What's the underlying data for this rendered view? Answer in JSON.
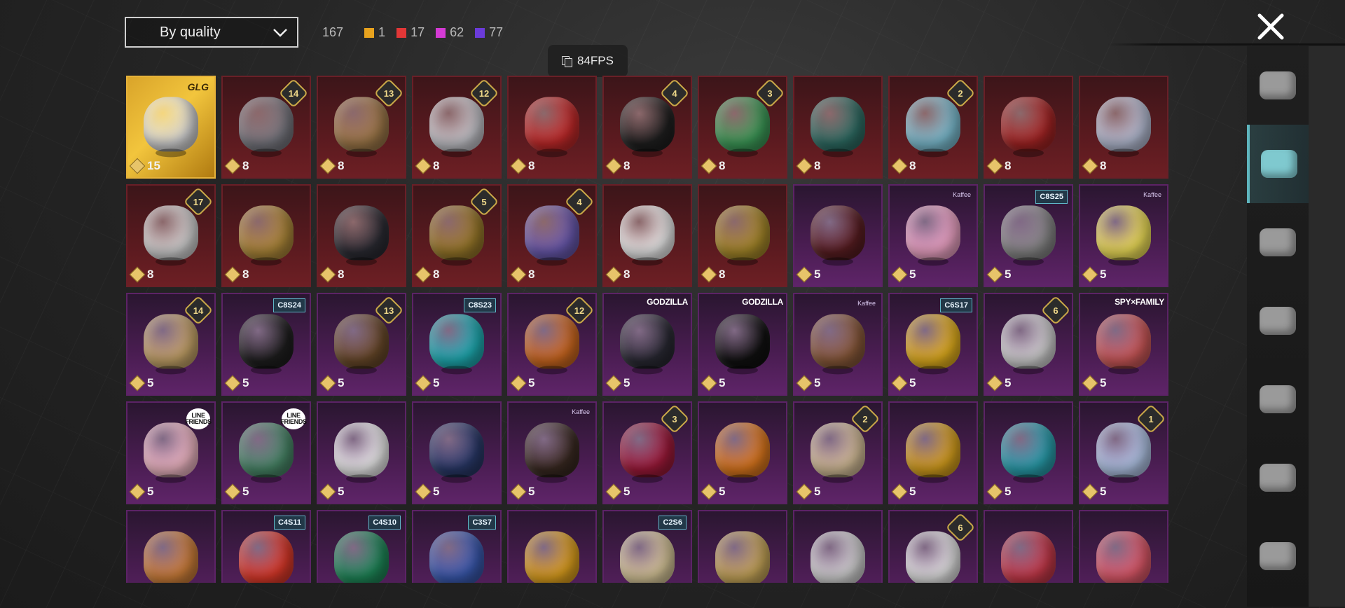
{
  "toolbar": {
    "sort_label": "By quality",
    "total": "167",
    "counts": [
      {
        "color": "#e7a21e",
        "value": "1"
      },
      {
        "color": "#e23737",
        "value": "17"
      },
      {
        "color": "#d43ad4",
        "value": "62"
      },
      {
        "color": "#6b3bd9",
        "value": "77"
      }
    ]
  },
  "overlay": {
    "fps": "84FPS"
  },
  "categories": [
    {
      "name": "glove-icon",
      "selected": false
    },
    {
      "name": "hat-icon",
      "selected": true
    },
    {
      "name": "glasses-icon",
      "selected": false
    },
    {
      "name": "mask-icon",
      "selected": false
    },
    {
      "name": "jacket-icon",
      "selected": false
    },
    {
      "name": "backpack-icon",
      "selected": false
    },
    {
      "name": "pants-icon",
      "selected": false
    }
  ],
  "items": [
    {
      "quality": "gold",
      "points": "15",
      "logo": "GLG"
    },
    {
      "quality": "red",
      "points": "8",
      "badge": "14"
    },
    {
      "quality": "red",
      "points": "8",
      "badge": "13"
    },
    {
      "quality": "red",
      "points": "8",
      "badge": "12"
    },
    {
      "quality": "red",
      "points": "8"
    },
    {
      "quality": "red",
      "points": "8",
      "badge": "4"
    },
    {
      "quality": "red",
      "points": "8",
      "badge": "3"
    },
    {
      "quality": "red",
      "points": "8"
    },
    {
      "quality": "red",
      "points": "8",
      "badge": "2"
    },
    {
      "quality": "red",
      "points": "8"
    },
    {
      "quality": "red",
      "points": "8"
    },
    {
      "quality": "red",
      "points": "8",
      "badge": "17"
    },
    {
      "quality": "red",
      "points": "8"
    },
    {
      "quality": "red",
      "points": "8"
    },
    {
      "quality": "red",
      "points": "8",
      "badge": "5"
    },
    {
      "quality": "red",
      "points": "8",
      "badge": "4"
    },
    {
      "quality": "red",
      "points": "8"
    },
    {
      "quality": "red",
      "points": "8"
    },
    {
      "quality": "purple",
      "points": "5"
    },
    {
      "quality": "purple",
      "points": "5",
      "kaffee": "Kaffee"
    },
    {
      "quality": "purple",
      "points": "5",
      "tag": "C8S25"
    },
    {
      "quality": "purple",
      "points": "5",
      "kaffee": "Kaffee"
    },
    {
      "quality": "purple",
      "points": "5",
      "badge": "14"
    },
    {
      "quality": "purple",
      "points": "5",
      "tag": "C8S24"
    },
    {
      "quality": "purple",
      "points": "5",
      "badge": "13"
    },
    {
      "quality": "purple",
      "points": "5",
      "tag": "C8S23"
    },
    {
      "quality": "purple",
      "points": "5",
      "badge": "12"
    },
    {
      "quality": "purple",
      "points": "5",
      "brand": "GODZILLA"
    },
    {
      "quality": "purple",
      "points": "5",
      "brand": "GODZILLA"
    },
    {
      "quality": "purple",
      "points": "5",
      "kaffee": "Kaffee"
    },
    {
      "quality": "purple",
      "points": "5",
      "tag": "C6S17"
    },
    {
      "quality": "purple",
      "points": "5",
      "badge": "6"
    },
    {
      "quality": "purple",
      "points": "5",
      "brand": "SPY×FAMILY"
    },
    {
      "quality": "purple",
      "points": "5",
      "line": "LINE FRIENDS"
    },
    {
      "quality": "purple",
      "points": "5",
      "line": "LINE FRIENDS"
    },
    {
      "quality": "purple",
      "points": "5"
    },
    {
      "quality": "purple",
      "points": "5"
    },
    {
      "quality": "purple",
      "points": "5",
      "kaffee": "Kaffee"
    },
    {
      "quality": "purple",
      "points": "5",
      "badge": "3"
    },
    {
      "quality": "purple",
      "points": "5"
    },
    {
      "quality": "purple",
      "points": "5",
      "badge": "2"
    },
    {
      "quality": "purple",
      "points": "5"
    },
    {
      "quality": "purple",
      "points": "5"
    },
    {
      "quality": "purple",
      "points": "5",
      "badge": "1"
    },
    {
      "quality": "purple",
      "points": ""
    },
    {
      "quality": "purple",
      "points": "",
      "tag": "C4S11"
    },
    {
      "quality": "purple",
      "points": "",
      "tag": "C4S10"
    },
    {
      "quality": "purple",
      "points": "",
      "tag": "C3S7"
    },
    {
      "quality": "purple",
      "points": ""
    },
    {
      "quality": "purple",
      "points": "",
      "tag": "C2S6"
    },
    {
      "quality": "purple",
      "points": ""
    },
    {
      "quality": "purple",
      "points": ""
    },
    {
      "quality": "purple",
      "points": "",
      "badge": "6"
    },
    {
      "quality": "purple",
      "points": ""
    },
    {
      "quality": "purple",
      "points": ""
    }
  ],
  "art_colors": [
    "#d9d9d9",
    "#7a7a82",
    "#a07a4a",
    "#c9c9cf",
    "#c42a2a",
    "#202020",
    "#3e9e5a",
    "#2f6f66",
    "#7fc2d6",
    "#a82525",
    "#b9c1d8",
    "#d6d6d6",
    "#b08a3a",
    "#2c2c34",
    "#9a7a2a",
    "#6a5ab0",
    "#efefef",
    "#a88a2a",
    "#5a1e22",
    "#f1a6c8",
    "#8a8a8a",
    "#f3e35a",
    "#c8a66a",
    "#1f1f1f",
    "#6a4a2a",
    "#1fb0b6",
    "#d06a20",
    "#2a2a34",
    "#111111",
    "#8a5a3a",
    "#e6b21e",
    "#d6d6d6",
    "#d05a5a",
    "#f2b9c6",
    "#4a8a6a",
    "#f0f0f0",
    "#2a3a6a",
    "#3a2a22",
    "#a01a3a",
    "#e07a1e",
    "#d7c09a",
    "#d9a21e",
    "#2aa2b0",
    "#b4c8ea",
    "#d0803a",
    "#e03a2a",
    "#1f8a5a",
    "#3a5ab0",
    "#e0a21e",
    "#d9c89a",
    "#c9a85a",
    "#d6d6d6",
    "#e6e6e6",
    "#c83a4a",
    "#e05a6a"
  ]
}
